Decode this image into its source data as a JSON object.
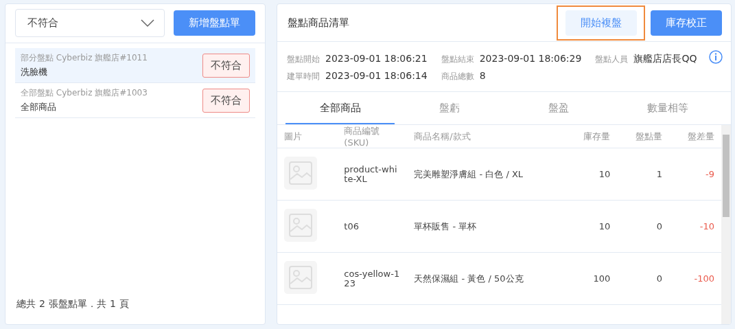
{
  "filter": {
    "value": "不符合"
  },
  "new_button": "新增盤點單",
  "count_sheets": [
    {
      "meta": "部分盤點 Cyberbiz 旗艦店#1011",
      "name": "洗臉機",
      "status": "不符合",
      "selected": true
    },
    {
      "meta": "全部盤點 Cyberbiz 旗艦店#1003",
      "name": "全部商品",
      "status": "不符合",
      "selected": false
    }
  ],
  "summary": {
    "prefix": "總共",
    "sheets": "2",
    "middle": "張盤點單．共",
    "pages": "1",
    "suffix": "頁"
  },
  "detail": {
    "title": "盤點商品清單",
    "buttons": [
      {
        "label": "開始複盤",
        "kind": "secondary",
        "highlighted": true
      },
      {
        "label": "庫存校正",
        "kind": "primary",
        "highlighted": false
      }
    ],
    "info_rows": [
      [
        {
          "label": "盤點開始",
          "value": "2023-09-01 18:06:21"
        },
        {
          "label": "盤點結束",
          "value": "2023-09-01 18:06:29"
        },
        {
          "label": "盤點人員",
          "value": "旗艦店店長QQ"
        }
      ],
      [
        {
          "label": "建單時間",
          "value": "2023-09-01 18:06:14"
        },
        {
          "label": "商品總數",
          "value": "8"
        }
      ]
    ],
    "tabs": [
      {
        "label": "全部商品",
        "selected": true
      },
      {
        "label": "盤虧",
        "selected": false
      },
      {
        "label": "盤盈",
        "selected": false
      },
      {
        "label": "數量相等",
        "selected": false
      }
    ],
    "table": {
      "columns": [
        "圖片",
        "商品編號(SKU)",
        "商品名稱/款式",
        "庫存量",
        "盤點量",
        "盤差量"
      ],
      "rows": [
        {
          "sku": "product-white-XL",
          "name": "完美雕塑淨膚組 - 白色 / XL",
          "stock": "10",
          "counted": "1",
          "difference": "-9"
        },
        {
          "sku": "t06",
          "name": "單杯販售 - 單杯",
          "stock": "10",
          "counted": "0",
          "difference": "-10"
        },
        {
          "sku": "cos-yellow-123",
          "name": "天然保濕組 - 黃色 / 50公克",
          "stock": "100",
          "counted": "0",
          "difference": "-100"
        }
      ]
    }
  }
}
